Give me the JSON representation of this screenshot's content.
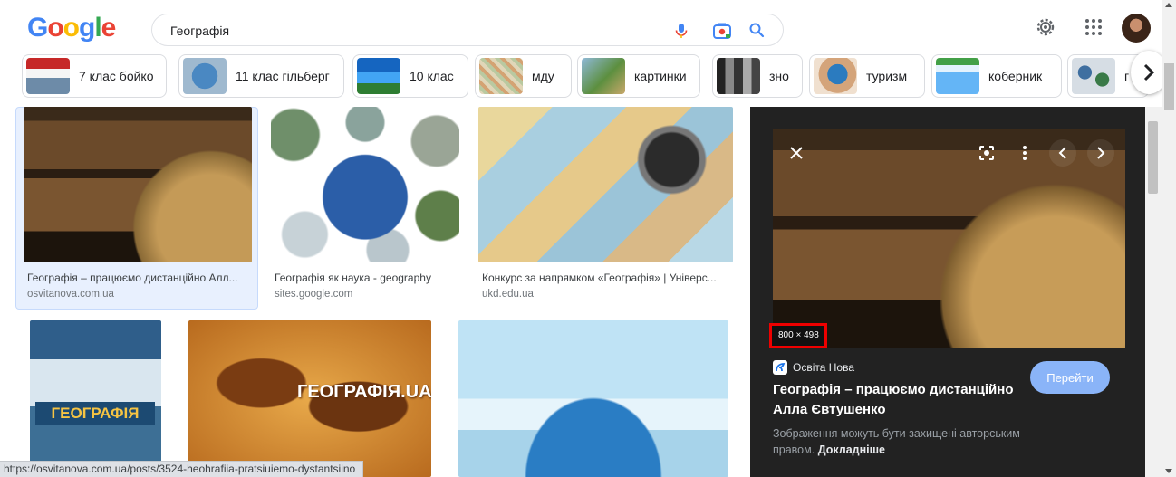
{
  "header": {
    "logo": [
      "G",
      "o",
      "o",
      "g",
      "l",
      "e"
    ],
    "logo_colors": [
      "#4285F4",
      "#EA4335",
      "#FBBC05",
      "#4285F4",
      "#34A853",
      "#EA4335"
    ],
    "search_value": "Географія",
    "search_placeholder": ""
  },
  "chips": [
    {
      "label": "7 клас бойко"
    },
    {
      "label": "11 клас гільберг"
    },
    {
      "label": "10 клас"
    },
    {
      "label": "мду"
    },
    {
      "label": "картинки"
    },
    {
      "label": "зно"
    },
    {
      "label": "туризм"
    },
    {
      "label": "коберник"
    },
    {
      "label": "г"
    }
  ],
  "results": [
    {
      "caption": "Географія – працюємо дистанційно Алл...",
      "source": "osvitanova.com.ua"
    },
    {
      "caption": "Географія як наука - geography",
      "source": "sites.google.com"
    },
    {
      "caption": "Конкурс за напрямком «Географія» | Універс...",
      "source": "ukd.edu.ua"
    },
    {
      "caption": "",
      "source": "",
      "book_title": "ГЕОГРАФІЯ"
    },
    {
      "caption": "",
      "source": "",
      "overlay": "ГЕОГРАФІЯ.UA"
    },
    {
      "caption": "",
      "source": ""
    }
  ],
  "preview": {
    "dimensions": "800 × 498",
    "site_name": "Освіта Нова",
    "title": "Географія – працюємо дистанційно Алла Євтушенко",
    "visit_label": "Перейти",
    "rights_text": "Зображення можуть бути захищені авторським правом.",
    "rights_link": "Докладніше"
  },
  "status_url": "https://osvitanova.com.ua/posts/3524-heohrafiia-pratsiuiemo-dystantsiino"
}
